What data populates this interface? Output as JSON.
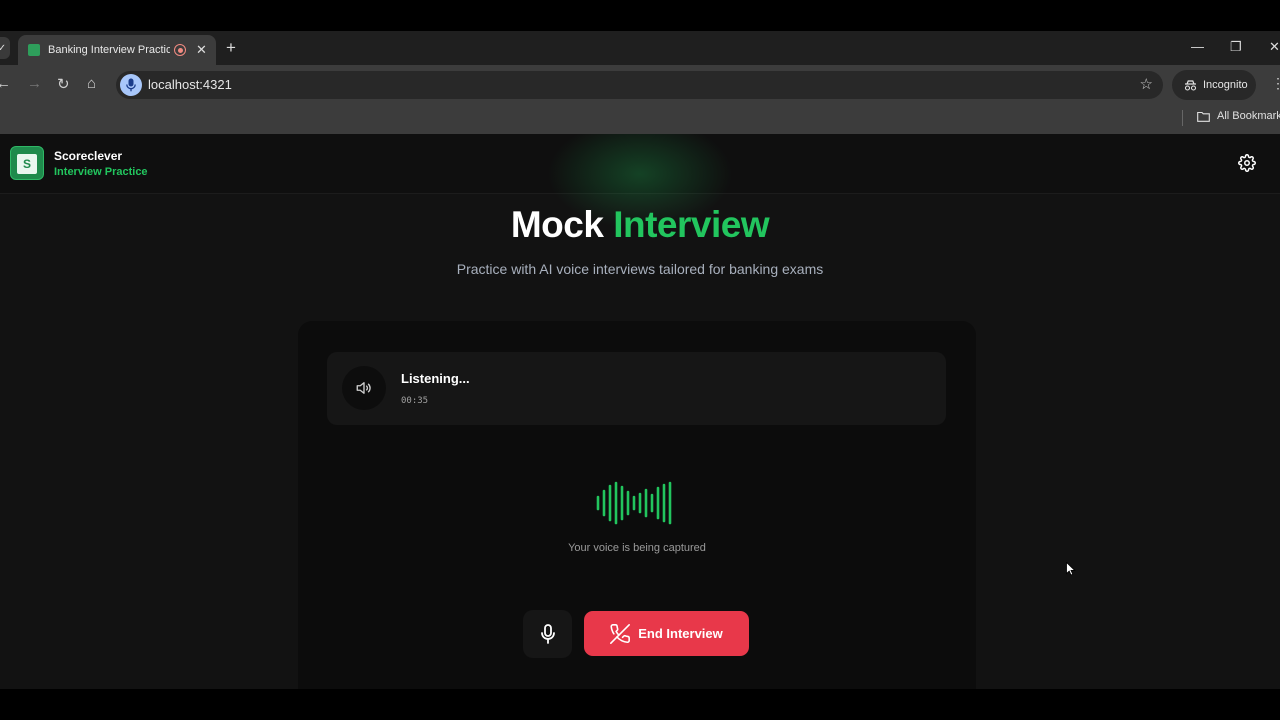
{
  "browser": {
    "tab_title": "Banking Interview Practice |",
    "url": "localhost:4321",
    "incognito_label": "Incognito",
    "bookmarks_label": "All Bookmarks",
    "icons": [
      "back-icon",
      "forward-icon",
      "reload-icon",
      "home-icon",
      "star-icon",
      "incognito-icon",
      "folder-icon"
    ]
  },
  "header": {
    "brand_name": "Scoreclever",
    "brand_subtitle": "Interview Practice",
    "logo_text": "S",
    "settings_icon": "gear-icon"
  },
  "hero": {
    "title_plain": "Mock",
    "title_accent": "Interview",
    "subtitle": "Practice with AI voice interviews tailored for banking exams"
  },
  "session": {
    "status_label": "Listening...",
    "elapsed": "00:35",
    "capture_text": "Your voice is being captured",
    "end_button_label": "End Interview"
  },
  "colors": {
    "accent_green": "#22c55e",
    "danger_red": "#e8384a",
    "background": "#121212"
  }
}
